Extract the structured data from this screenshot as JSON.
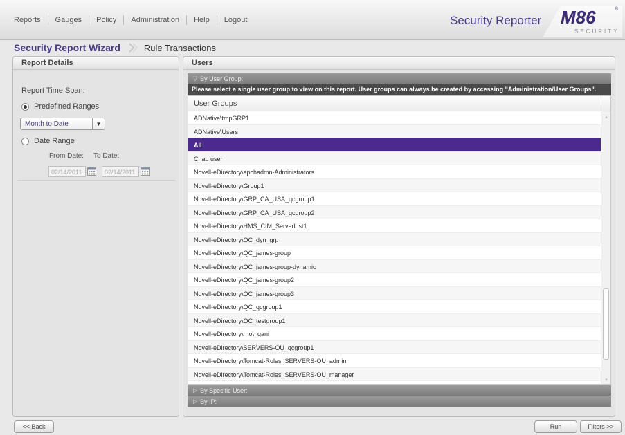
{
  "nav": {
    "items": [
      "Reports",
      "Gauges",
      "Policy",
      "Administration",
      "Help",
      "Logout"
    ]
  },
  "product": {
    "title": "Security Reporter",
    "logo_text": "M86",
    "logo_sub": "SECURITY",
    "logo_mark": "®"
  },
  "breadcrumb": {
    "wizard": "Security Report Wizard",
    "page": "Rule Transactions"
  },
  "report_details": {
    "header": "Report Details",
    "time_span_label": "Report Time Span:",
    "predefined_label": "Predefined Ranges",
    "predefined_selected": true,
    "range_value": "Month to Date",
    "date_range_label": "Date Range",
    "from_label": "From Date:",
    "to_label": "To Date:",
    "from_value": "02/14/2011",
    "to_value": "02/14/2011"
  },
  "users": {
    "header": "Users",
    "by_user_group_label": "By User Group:",
    "notice": "Please select a single user group to view on this report. User groups can always be created by accessing \"Administration/User Groups\".",
    "grid_header": "User Groups",
    "selected_index": 2,
    "groups": [
      "ADNative\\tmpGRP1",
      "ADNative\\Users",
      "All",
      "Chau user",
      "Novell-eDirectory\\apchadmn-Administrators",
      "Novell-eDirectory\\Group1",
      "Novell-eDirectory\\GRP_CA_USA_qcgroup1",
      "Novell-eDirectory\\GRP_CA_USA_qcgroup2",
      "Novell-eDirectory\\HMS_CIM_ServerList1",
      "Novell-eDirectory\\QC_dyn_grp",
      "Novell-eDirectory\\QC_james-group",
      "Novell-eDirectory\\QC_james-group-dynamic",
      "Novell-eDirectory\\QC_james-group2",
      "Novell-eDirectory\\QC_james-group3",
      "Novell-eDirectory\\QC_qcgroup1",
      "Novell-eDirectory\\QC_testgroup1",
      "Novell-eDirectory\\rno\\_gani",
      "Novell-eDirectory\\SERVERS-OU_qcgroup1",
      "Novell-eDirectory\\Tomcat-Roles_SERVERS-OU_admin",
      "Novell-eDirectory\\Tomcat-Roles_SERVERS-OU_manager"
    ],
    "by_specific_user_label": "By Specific User:",
    "by_ip_label": "By IP:"
  },
  "buttons": {
    "back": "<< Back",
    "run": "Run",
    "filters": "Filters >>"
  },
  "colors": {
    "accent": "#4b2a8f",
    "brand_text": "#4b3a87"
  }
}
